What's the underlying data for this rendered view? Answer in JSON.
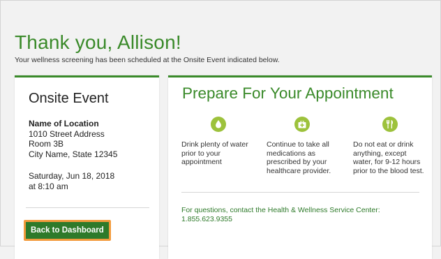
{
  "header": {
    "title": "Thank you, Allison!",
    "subtitle": "Your wellness screening has been scheduled at the Onsite Event indicated below."
  },
  "event": {
    "title": "Onsite Event",
    "location_name": "Name of Location",
    "address_line1": "1010 Street Address",
    "address_line2": "Room 3B",
    "city_state_zip": "City Name, State 12345",
    "date": "Saturday, Jun 18, 2018",
    "time": "at 8:10 am",
    "back_button_label": "Back to Dashboard"
  },
  "prepare": {
    "title": "Prepare For Your Appointment",
    "items": [
      {
        "icon": "water-drop-icon",
        "text": "Drink plenty of water prior to your appointment"
      },
      {
        "icon": "medication-kit-icon",
        "text": "Continue to take all medications as prescribed by your healthcare provider."
      },
      {
        "icon": "utensils-icon",
        "text": "Do not eat or drink anything, except water, for 9-12 hours prior to the blood test."
      }
    ],
    "questions_line1": "For questions, contact the Health & Wellness Service Center:",
    "questions_line2": "1.855.623.9355"
  },
  "colors": {
    "brand_green": "#3a8a2a",
    "button_green": "#2e7a2a",
    "icon_green": "#9dc23c",
    "highlight_orange": "#f39a3c"
  }
}
